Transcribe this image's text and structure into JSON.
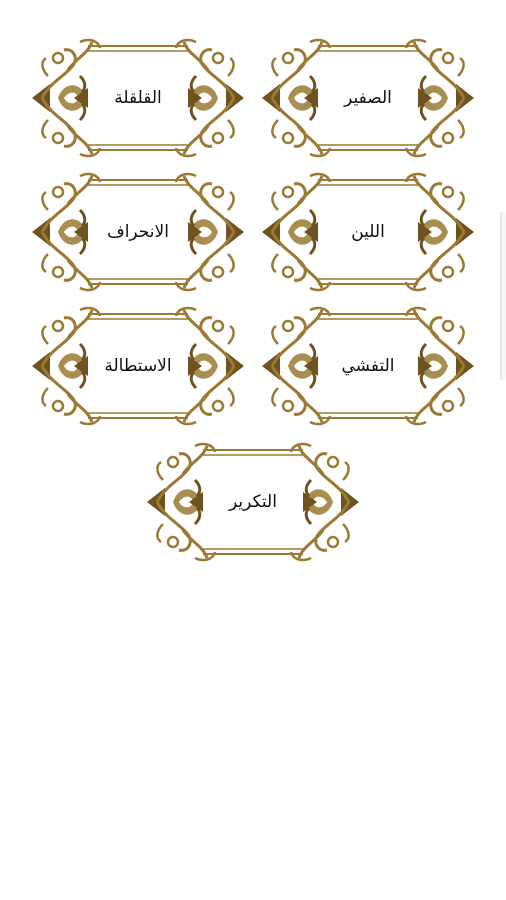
{
  "theme": {
    "ornament_color": "#9a7a34",
    "ornament_dark": "#6e5220",
    "background": "#ffffff"
  },
  "buttons": [
    {
      "id": "safir",
      "label": "الصفير"
    },
    {
      "id": "qalqala",
      "label": "القلقلة"
    },
    {
      "id": "leen",
      "label": "اللين"
    },
    {
      "id": "inhiraf",
      "label": "الانحراف"
    },
    {
      "id": "tafashshi",
      "label": "التفشي"
    },
    {
      "id": "istitala",
      "label": "الاستطالة"
    },
    {
      "id": "takrir",
      "label": "التكرير"
    }
  ]
}
